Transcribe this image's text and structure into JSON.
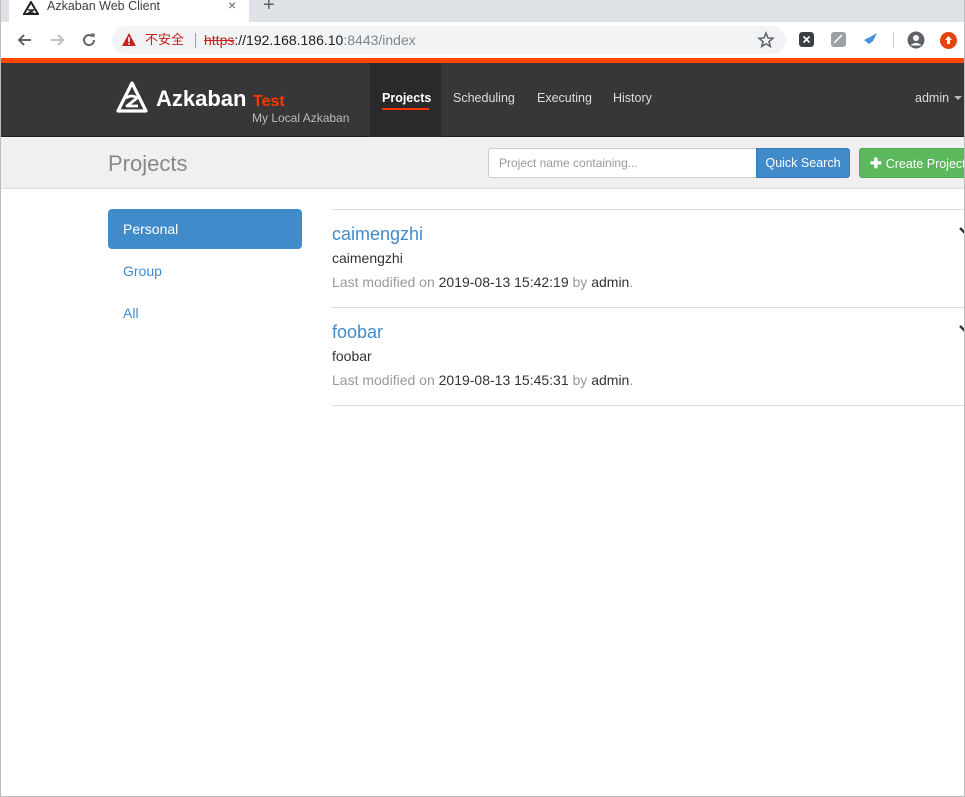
{
  "browser": {
    "tab_title": "Azkaban Web Client",
    "tab_close": "×",
    "new_tab": "+",
    "insecure_label": "不安全",
    "url_scheme": "https",
    "url_host": "://192.168.186.10",
    "url_rest": ":8443/index"
  },
  "navbar": {
    "brand": "Azkaban",
    "env": "Test",
    "subtitle": "My Local Azkaban",
    "items": [
      "Projects",
      "Scheduling",
      "Executing",
      "History"
    ],
    "active_item": "Projects",
    "user": "admin",
    "accent_color": "#ff3601"
  },
  "header": {
    "title": "Projects",
    "search_placeholder": "Project name containing...",
    "quick_search_label": "Quick Search",
    "create_project_label": "Create Project"
  },
  "sidebar": {
    "items": [
      "Personal",
      "Group",
      "All"
    ],
    "active_item": "Personal"
  },
  "projects": [
    {
      "name": "caimengzhi",
      "description": "caimengzhi",
      "meta_prefix": "Last modified on",
      "modified": "2019-08-13 15:42:19",
      "meta_by": "by",
      "user": "admin",
      "meta_suffix": "."
    },
    {
      "name": "foobar",
      "description": "foobar",
      "meta_prefix": "Last modified on",
      "modified": "2019-08-13 15:45:31",
      "meta_by": "by",
      "user": "admin",
      "meta_suffix": "."
    }
  ]
}
